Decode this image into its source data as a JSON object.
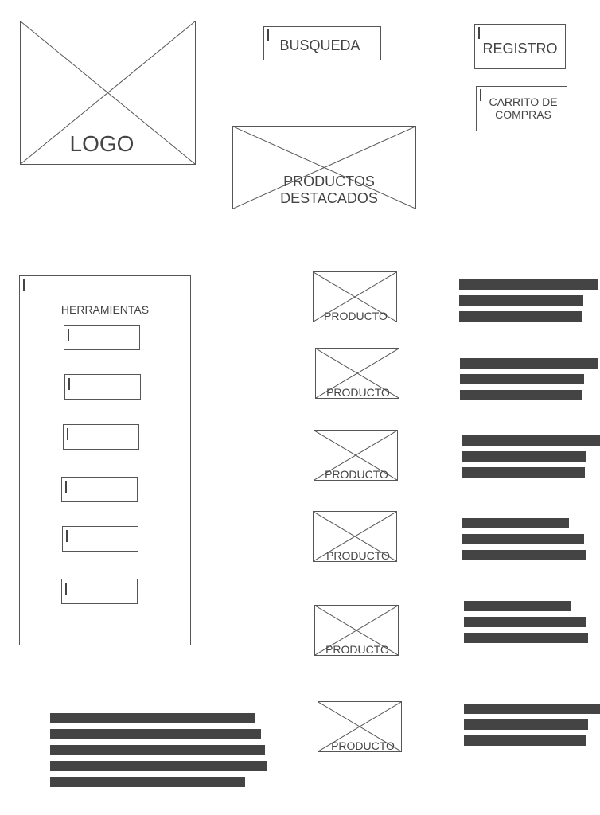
{
  "header": {
    "logo_label": "LOGO",
    "search_label": "BUSQUEDA",
    "register_label": "REGISTRO",
    "cart_label": "CARRITO DE\nCOMPRAS",
    "featured_label": "PRODUCTOS\nDESTACADOS"
  },
  "sidebar": {
    "title": "HERRAMIENTAS",
    "tool_count": 6
  },
  "products": {
    "label": "PRODUCTO",
    "count": 6
  },
  "colors": {
    "line": "#555555",
    "text": "#444444",
    "bar": "#444444",
    "background": "#ffffff"
  }
}
